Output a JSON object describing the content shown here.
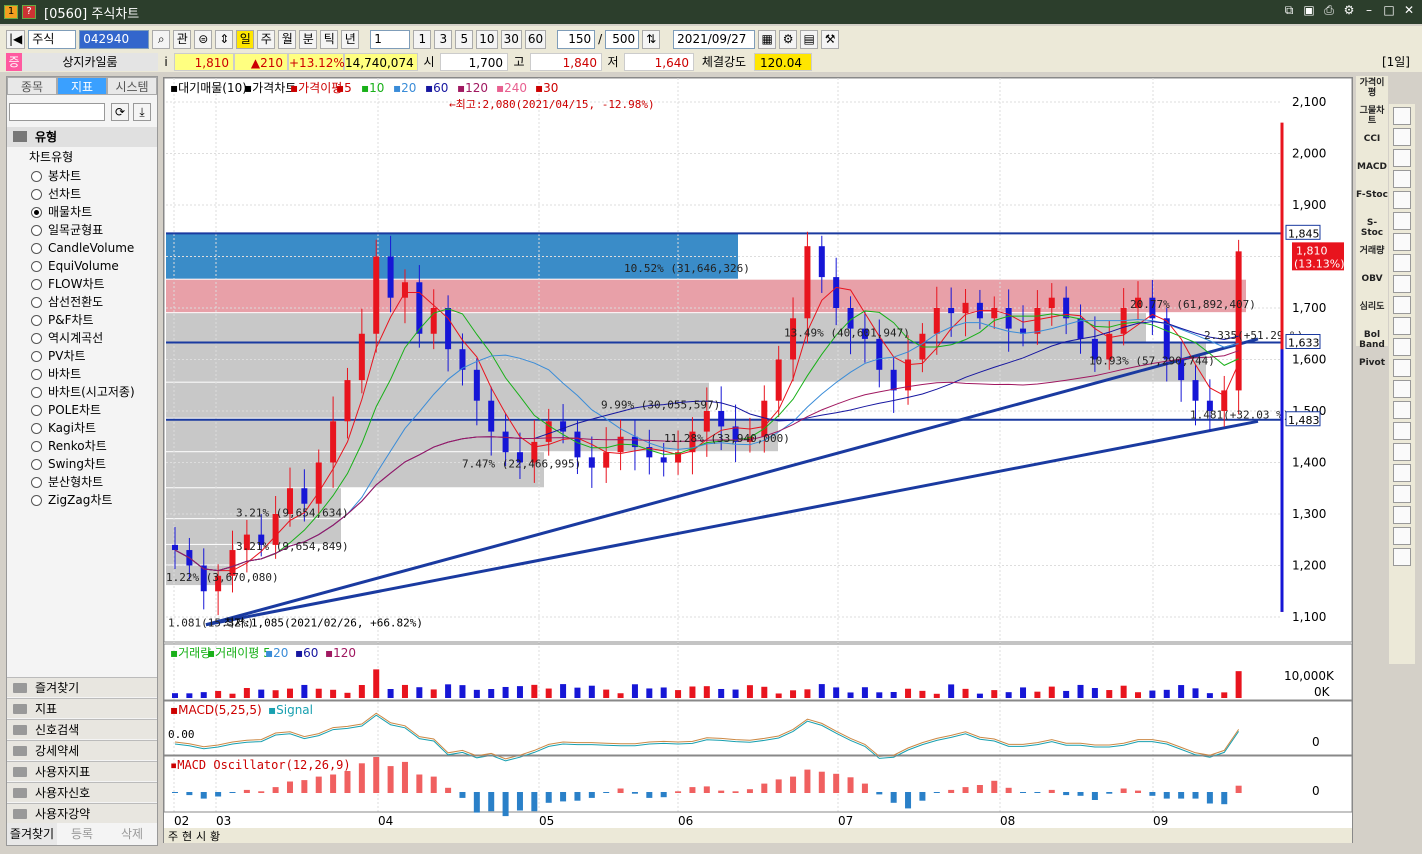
{
  "window": {
    "title": "[0560] 주식차트",
    "badge_nums": [
      "1",
      "?"
    ]
  },
  "toolbar": {
    "market": "주식",
    "code": "042940",
    "search_btn": "관",
    "periods": [
      "일",
      "주",
      "월",
      "분",
      "틱",
      "년"
    ],
    "period_selected": "일",
    "interval": "1",
    "quick": [
      "1",
      "3",
      "5",
      "10",
      "30",
      "60"
    ],
    "count": "150",
    "total": "500",
    "date": "2021/09/27"
  },
  "quote": {
    "badge": "증",
    "name": "상지카일룸",
    "info": "i",
    "price": "1,810",
    "change": "▲210",
    "pct": "+13.12%",
    "volume": "14,740,074",
    "open_lbl": "시",
    "open": "1,700",
    "high_lbl": "고",
    "high": "1,840",
    "low_lbl": "저",
    "low": "1,640",
    "strength_lbl": "체결강도",
    "strength": "120.04",
    "unit": "[1일]"
  },
  "left": {
    "tabs": [
      "종목",
      "지표",
      "시스템"
    ],
    "active_tab": "지표",
    "tree_root": "유형",
    "tree_node": "차트유형",
    "chart_types": [
      "봉차트",
      "선차트",
      "매물차트",
      "일목균형표",
      "CandleVolume",
      "EquiVolume",
      "FLOW차트",
      "삼선전환도",
      "P&F차트",
      "역시계곡선",
      "PV차트",
      "바차트",
      "바차트(시고저종)",
      "POLE차트",
      "Kagi차트",
      "Renko차트",
      "Swing차트",
      "분산형차트",
      "ZigZag차트"
    ],
    "selected": "매물차트",
    "sections": [
      "즐겨찾기",
      "지표",
      "신호검색",
      "강세약세",
      "사용자지표",
      "사용자신호",
      "사용자강약"
    ],
    "bottom": [
      "즐겨찾기",
      "등록",
      "삭제"
    ]
  },
  "main_panel": {
    "legend": [
      "대기매물(10)",
      "가격차트",
      "가격이평",
      "5",
      "10",
      "20",
      "60",
      "120",
      "240",
      "30"
    ],
    "high_note": "←최고:2,080(2021/04/15, -12.98%)",
    "low_note": "최저:1,085(2021/02/26, +66.82%)",
    "price_ticks": [
      "2,100",
      "2,000",
      "1,900",
      "1,800",
      "1,700",
      "1,600",
      "1,500",
      "1,400",
      "1,300",
      "1,200",
      "1,100"
    ],
    "tag_upper": "1,845",
    "tag_price": "1,810",
    "tag_pct": "(13.13%)",
    "tag_mid": "1,633",
    "tag_lower": "1,483",
    "profile": [
      "10.52% (31,646,326)",
      "20.77% (61,892,407)",
      "13.49% (40,601,947)",
      "10.93% (57,290,744)",
      "9.99% (30,055,597)",
      "11.28% (33,940,000)",
      "7.47% (22,466,995)",
      "3.21% (9,654,634)",
      "3.21% (9,654,849)",
      "1.22% (3,670,080)",
      "1.081(15.32%)",
      "2.335(+51.29 %)",
      "1.481(+32.03 %)"
    ]
  },
  "volume_panel": {
    "legend": [
      "거래량",
      "거래이평 5",
      "20",
      "60",
      "120"
    ],
    "ticks": [
      "10,000K",
      "0K"
    ]
  },
  "macd_panel": {
    "legend": [
      "MACD(5,25,5)",
      "Signal"
    ],
    "value": "0.00",
    "zero": "0"
  },
  "osc_panel": {
    "legend": "MACD Oscillator(12,26,9)",
    "zero": "0"
  },
  "xaxis": [
    "02",
    "03",
    "04",
    "05",
    "06",
    "07",
    "08",
    "09"
  ],
  "bottom_tabs": [
    "주",
    "현",
    "시",
    "황"
  ],
  "rtools": [
    "가격이평",
    "그물차트",
    "CCI",
    "MACD",
    "F-Stoc",
    "S-Stoc",
    "거래량",
    "OBV",
    "심리도",
    "Bol Band",
    "Pivot"
  ],
  "colors": {
    "up": "#e8141e",
    "down": "#1616d6",
    "zone_blue": "#3a8cc8",
    "zone_red": "#e8a0a8",
    "zone_gray": "#c8c8c8",
    "trend": "#1a3aa0"
  }
}
